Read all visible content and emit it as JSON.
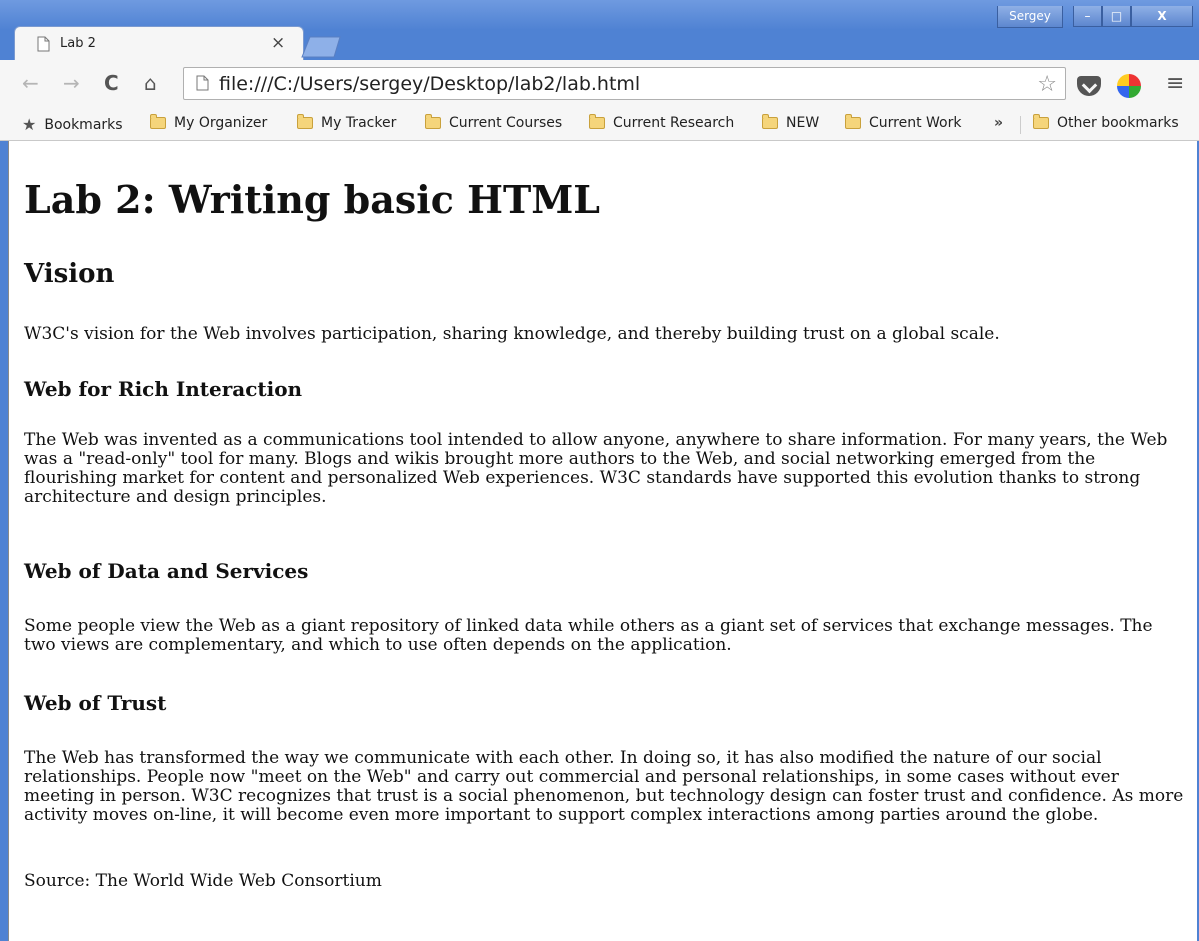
{
  "window": {
    "user_name": "Sergey",
    "minimize_label": "–",
    "maximize_label": "□",
    "close_label": "X"
  },
  "tab": {
    "title": "Lab 2",
    "close_label": "×"
  },
  "toolbar": {
    "back_label": "←",
    "forward_label": "→",
    "reload_label": "C",
    "home_label": "⌂",
    "url": "file:///C:/Users/sergey/Desktop/lab2/lab.html",
    "bookmark_star": "☆",
    "menu_label": "≡"
  },
  "bookmarks": {
    "items": [
      "Bookmarks",
      "My Organizer",
      "My Tracker",
      "Current Courses",
      "Current Research",
      "NEW",
      "Current Work"
    ],
    "overflow_label": "»",
    "other_label": "Other bookmarks"
  },
  "page": {
    "h1": "Lab 2: Writing basic HTML",
    "h2": "Vision",
    "p1": "W3C's vision for the Web involves participation, sharing knowledge, and thereby building trust on a global scale.",
    "h3a": "Web for Rich Interaction",
    "p2": "The Web was invented as a communications tool intended to allow anyone, anywhere to share information. For many years, the Web was a \"read-only\" tool for many. Blogs and wikis brought more authors to the Web, and social networking emerged from the flourishing market for content and personalized Web experiences. W3C standards have supported this evolution thanks to strong architecture and design principles.",
    "h3b": "Web of Data and Services",
    "p3": "Some people view the Web as a giant repository of linked data while others as a giant set of services that exchange messages. The two views are complementary, and which to use often depends on the application.",
    "h3c": "Web of Trust",
    "p4": "The Web has transformed the way we communicate with each other. In doing so, it has also modified the nature of our social relationships. People now \"meet on the Web\" and carry out commercial and personal relationships, in some cases without ever meeting in person. W3C recognizes that trust is a social phenomenon, but technology design can foster trust and confidence. As more activity moves on-line, it will become even more important to support complex interactions among parties around the globe.",
    "source": "Source: The World Wide Web Consortium"
  }
}
